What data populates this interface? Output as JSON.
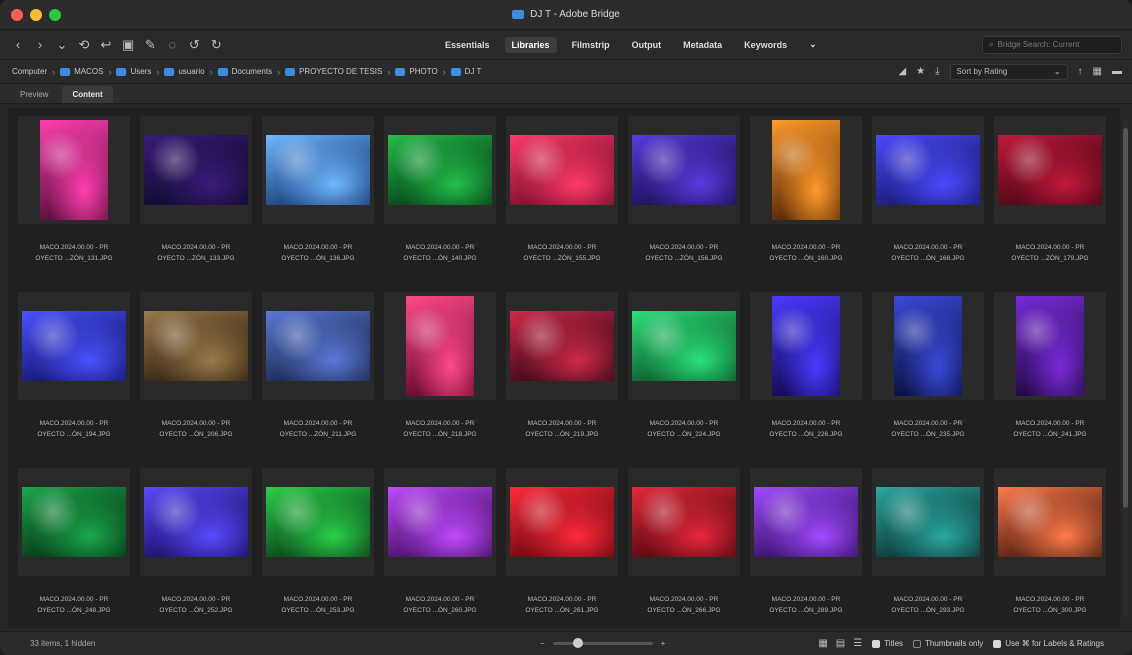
{
  "window": {
    "title": "DJ T - Adobe Bridge"
  },
  "toolbar": {
    "icons": [
      "back-icon",
      "forward-icon",
      "recent-icon",
      "return-icon",
      "boomerang-icon",
      "get-photos-icon",
      "refine-icon",
      "open-in-camera-raw-icon",
      "rotate-left-icon",
      "rotate-right-icon"
    ],
    "workspaces": [
      "Essentials",
      "Libraries",
      "Filmstrip",
      "Output",
      "Metadata",
      "Keywords"
    ],
    "active_workspace": "Libraries",
    "search_placeholder": "Bridge Search: Current"
  },
  "pathbar": {
    "crumbs": [
      "Computer",
      "MACOS",
      "Users",
      "usuario",
      "Documents",
      "PROYECTO DE TESIS",
      "PHOTO",
      "DJ T"
    ],
    "sort_label": "Sort by Rating"
  },
  "tabs": [
    {
      "label": "Preview"
    },
    {
      "label": "Content"
    }
  ],
  "active_tab": "Content",
  "thumbnails": [
    {
      "line1": "MACO.2024.00.00 - PR",
      "line2": "OYECTO ...ZÓN_131.JPG",
      "orient": "port",
      "c1": "#ff3fb0",
      "c2": "#5a0f3c"
    },
    {
      "line1": "MACO.2024.00.00 - PR",
      "line2": "OYECTO ...ZÓN_133.JPG",
      "orient": "land",
      "c1": "#3a1a7a",
      "c2": "#0a0a22"
    },
    {
      "line1": "MACO.2024.00.00 - PR",
      "line2": "OYECTO ...ÓN_136.JPG",
      "orient": "land",
      "c1": "#6fb8ff",
      "c2": "#10306a"
    },
    {
      "line1": "MACO.2024.00.00 - PR",
      "line2": "OYECTO ...ÓN_140.JPG",
      "orient": "land",
      "c1": "#22c04a",
      "c2": "#053312"
    },
    {
      "line1": "MACO.2024.00.00 - PR",
      "line2": "OYECTO ...ZÓN_155.JPG",
      "orient": "land",
      "c1": "#ff3a6a",
      "c2": "#6a0a22"
    },
    {
      "line1": "MACO.2024.00.00 - PR",
      "line2": "OYECTO ...ZÓN_156.JPG",
      "orient": "land",
      "c1": "#5a3adf",
      "c2": "#150a44"
    },
    {
      "line1": "MACO.2024.00.00 - PR",
      "line2": "OYECTO ...ÓN_160.JPG",
      "orient": "port",
      "c1": "#ff9a2a",
      "c2": "#5a2a05"
    },
    {
      "line1": "MACO.2024.00.00 - PR",
      "line2": "OYECTO ...ÓN_168.JPG",
      "orient": "land",
      "c1": "#4a4aff",
      "c2": "#141460"
    },
    {
      "line1": "MACO.2024.00.00 - PR",
      "line2": "OYECTO ...ZÓN_179.JPG",
      "orient": "land",
      "c1": "#c2183a",
      "c2": "#3a0512"
    },
    {
      "line1": "MACO.2024.00.00 - PR",
      "line2": "OYECTO ...ÓN_194.JPG",
      "orient": "land",
      "c1": "#4a52ff",
      "c2": "#101060"
    },
    {
      "line1": "MACO.2024.00.00 - PR",
      "line2": "OYECTO ...ÓN_206.JPG",
      "orient": "land",
      "c1": "#9a7a4a",
      "c2": "#2a1a0a"
    },
    {
      "line1": "MACO.2024.00.00 - PR",
      "line2": "OYECTO ...ZÓN_211.JPG",
      "orient": "land",
      "c1": "#5a7ad8",
      "c2": "#142040"
    },
    {
      "line1": "MACO.2024.00.00 - PR",
      "line2": "OYECTO ...ÓN_218.JPG",
      "orient": "port",
      "c1": "#ff4a8a",
      "c2": "#6a0a30"
    },
    {
      "line1": "MACO.2024.00.00 - PR",
      "line2": "OYECTO ...ÓN_219.JPG",
      "orient": "land",
      "c1": "#d02a4a",
      "c2": "#2a0410"
    },
    {
      "line1": "MACO.2024.00.00 - PR",
      "line2": "OYECTO ...ÓN_224.JPG",
      "orient": "land",
      "c1": "#2ae27a",
      "c2": "#0a4a24"
    },
    {
      "line1": "MACO.2024.00.00 - PR",
      "line2": "OYECTO ...ÓN_226.JPG",
      "orient": "port",
      "c1": "#4a3aff",
      "c2": "#120a55"
    },
    {
      "line1": "MACO.2024.00.00 - PR",
      "line2": "OYECTO ...ÓN_235.JPG",
      "orient": "port",
      "c1": "#3a4ad8",
      "c2": "#0a1040"
    },
    {
      "line1": "MACO.2024.00.00 - PR",
      "line2": "OYECTO ...ÓN_241.JPG",
      "orient": "port",
      "c1": "#7a2ad8",
      "c2": "#1f0a44"
    },
    {
      "line1": "MACO.2024.00.00 - PR",
      "line2": "OYECTO ...ÓN_248.JPG",
      "orient": "land",
      "c1": "#1aa84a",
      "c2": "#052a12"
    },
    {
      "line1": "MACO.2024.00.00 - PR",
      "line2": "OYECTO ...ÓN_252.JPG",
      "orient": "land",
      "c1": "#5a4aff",
      "c2": "#150a55"
    },
    {
      "line1": "MACO.2024.00.00 - PR",
      "line2": "OYECTO ...ÓN_253.JPG",
      "orient": "land",
      "c1": "#2ad04a",
      "c2": "#063312"
    },
    {
      "line1": "MACO.2024.00.00 - PR",
      "line2": "OYECTO ...ÓN_260.JPG",
      "orient": "land",
      "c1": "#c04aff",
      "c2": "#3a0a55"
    },
    {
      "line1": "MACO.2024.00.00 - PR",
      "line2": "OYECTO ...ÓN_261.JPG",
      "orient": "land",
      "c1": "#ff2a3a",
      "c2": "#5a050a"
    },
    {
      "line1": "MACO.2024.00.00 - PR",
      "line2": "OYECTO ...ÓN_266.JPG",
      "orient": "land",
      "c1": "#e8283a",
      "c2": "#40050c"
    },
    {
      "line1": "MACO.2024.00.00 - PR",
      "line2": "OYECTO ...ÓN_289.JPG",
      "orient": "land",
      "c1": "#a04aff",
      "c2": "#2a0a55"
    },
    {
      "line1": "MACO.2024.00.00 - PR",
      "line2": "OYECTO ...ÓN_293.JPG",
      "orient": "land",
      "c1": "#2aa8a0",
      "c2": "#0a2a2a"
    },
    {
      "line1": "MACO.2024.00.00 - PR",
      "line2": "OYECTO ...ÓN_300.JPG",
      "orient": "land",
      "c1": "#ff7a4a",
      "c2": "#3a140a"
    }
  ],
  "statusbar": {
    "items_count": "33 items, 1 hidden",
    "zoom_level": 0.25,
    "titles_label": "Titles",
    "thumbnails_only_label": "Thumbnails only",
    "use_label": "Use ⌘ for Labels & Ratings"
  }
}
